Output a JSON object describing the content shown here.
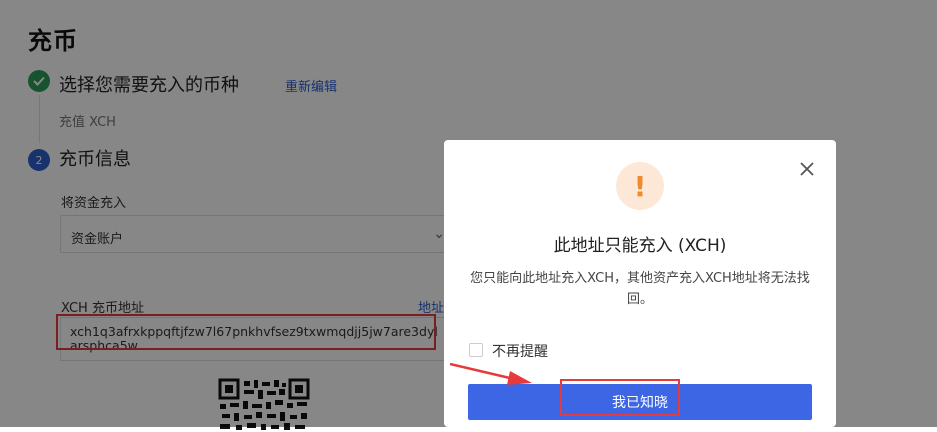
{
  "page": {
    "title": "充币"
  },
  "steps": {
    "step1": {
      "title": "选择您需要充入的币种",
      "edit_label": "重新编辑",
      "subtitle": "充值 XCH"
    },
    "step2": {
      "number": "2",
      "title": "充币信息"
    }
  },
  "form": {
    "fund_label": "将资金充入",
    "fund_value": "资金账户",
    "address_label": "XCH 充币地址",
    "address_link": "地址",
    "address_value": "xch1q3afrxkppqftjfzw7l67pnkhvfsez9txwmqdjj5jw7are3dylarsphca5w"
  },
  "modal": {
    "warning_glyph": "!",
    "title": "此地址只能充入 (XCH)",
    "body": "您只能向此地址充入XCH，其他资产充入XCH地址将无法找回。",
    "checkbox_label": "不再提醒",
    "confirm_label": "我已知晓"
  },
  "colors": {
    "accent": "#3c66e3",
    "success": "#2e9e5b",
    "warning": "#f08a2c",
    "annotation": "#e8393c"
  }
}
